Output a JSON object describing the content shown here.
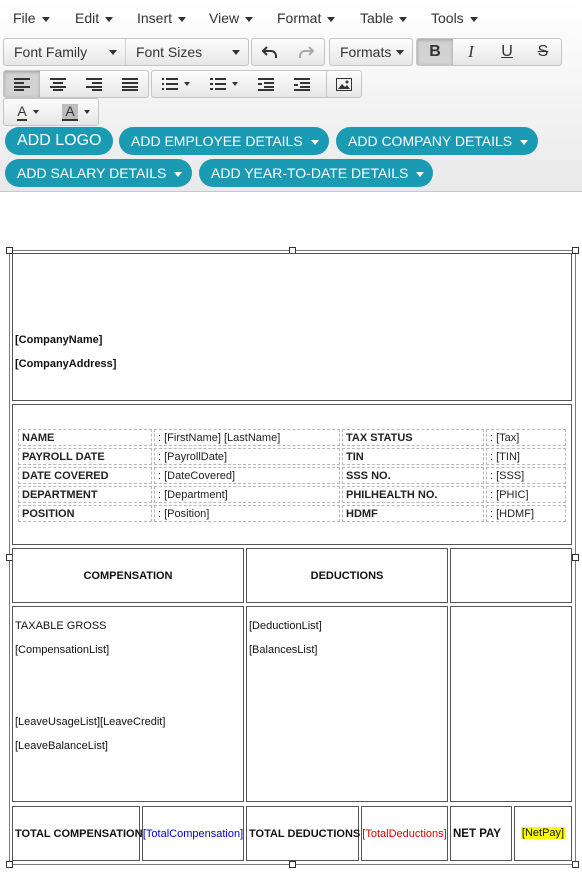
{
  "menubar": {
    "items": [
      {
        "label": "File"
      },
      {
        "label": "Edit"
      },
      {
        "label": "Insert"
      },
      {
        "label": "View"
      },
      {
        "label": "Format"
      },
      {
        "label": "Table"
      },
      {
        "label": "Tools"
      }
    ]
  },
  "toolbar": {
    "font_family": "Font Family",
    "font_sizes": "Font Sizes",
    "formats": "Formats",
    "bold_label": "B",
    "italic_label": "I",
    "underline_label": "U",
    "strike_label": "S",
    "text_color_label": "A",
    "bg_color_label": "A",
    "icons": [
      "undo-icon",
      "redo-icon",
      "align-left-icon",
      "align-center-icon",
      "align-right-icon",
      "align-justify-icon",
      "bullet-list-icon",
      "numbered-list-icon",
      "outdent-icon",
      "indent-icon",
      "image-icon"
    ]
  },
  "buttons": {
    "add_logo": "ADD LOGO",
    "add_employee": "ADD EMPLOYEE DETAILS",
    "add_company": "ADD COMPANY DETAILS",
    "add_salary": "ADD SALARY DETAILS",
    "add_ytd": "ADD YEAR-TO-DATE DETAILS"
  },
  "document": {
    "company_name": "[CompanyName]",
    "company_address": "[CompanyAddress]",
    "info_rows": [
      {
        "label1": "NAME",
        "value1": ": [FirstName] [LastName]",
        "label2": "TAX STATUS",
        "value2": ": [Tax]"
      },
      {
        "label1": "PAYROLL DATE",
        "value1": ": [PayrollDate]",
        "label2": "TIN",
        "value2": ": [TIN]"
      },
      {
        "label1": "DATE COVERED",
        "value1": ": [DateCovered]",
        "label2": "SSS NO.",
        "value2": ": [SSS]"
      },
      {
        "label1": "DEPARTMENT",
        "value1": ": [Department]",
        "label2": "PHILHEALTH NO.",
        "value2": ": [PHIC]"
      },
      {
        "label1": "POSITION",
        "value1": ": [Position]",
        "label2": "HDMF",
        "value2": ": [HDMF]"
      }
    ],
    "compensation_header": "COMPENSATION",
    "deductions_header": "DEDUCTIONS",
    "taxable_gross": "TAXABLE GROSS",
    "compensation_list": "[CompensationList]",
    "leave_usage": "[LeaveUsageList][LeaveCredit]",
    "leave_balance": "[LeaveBalanceList]",
    "deduction_list": "[DeductionList]",
    "balances_list": "[BalancesList]",
    "total_compensation_label": "TOTAL COMPENSATION",
    "total_compensation_value": "[TotalCompensation]",
    "total_deductions_label": "TOTAL DEDUCTIONS",
    "total_deductions_value": "[TotalDeductions]",
    "net_pay_label": "NET PAY",
    "net_pay_value": "[NetPay]"
  },
  "colors": {
    "accent": "#1a9bb3",
    "total_compensation": "#0000dd",
    "total_deductions": "#dd0000",
    "net_pay_highlight": "#ffff00"
  }
}
